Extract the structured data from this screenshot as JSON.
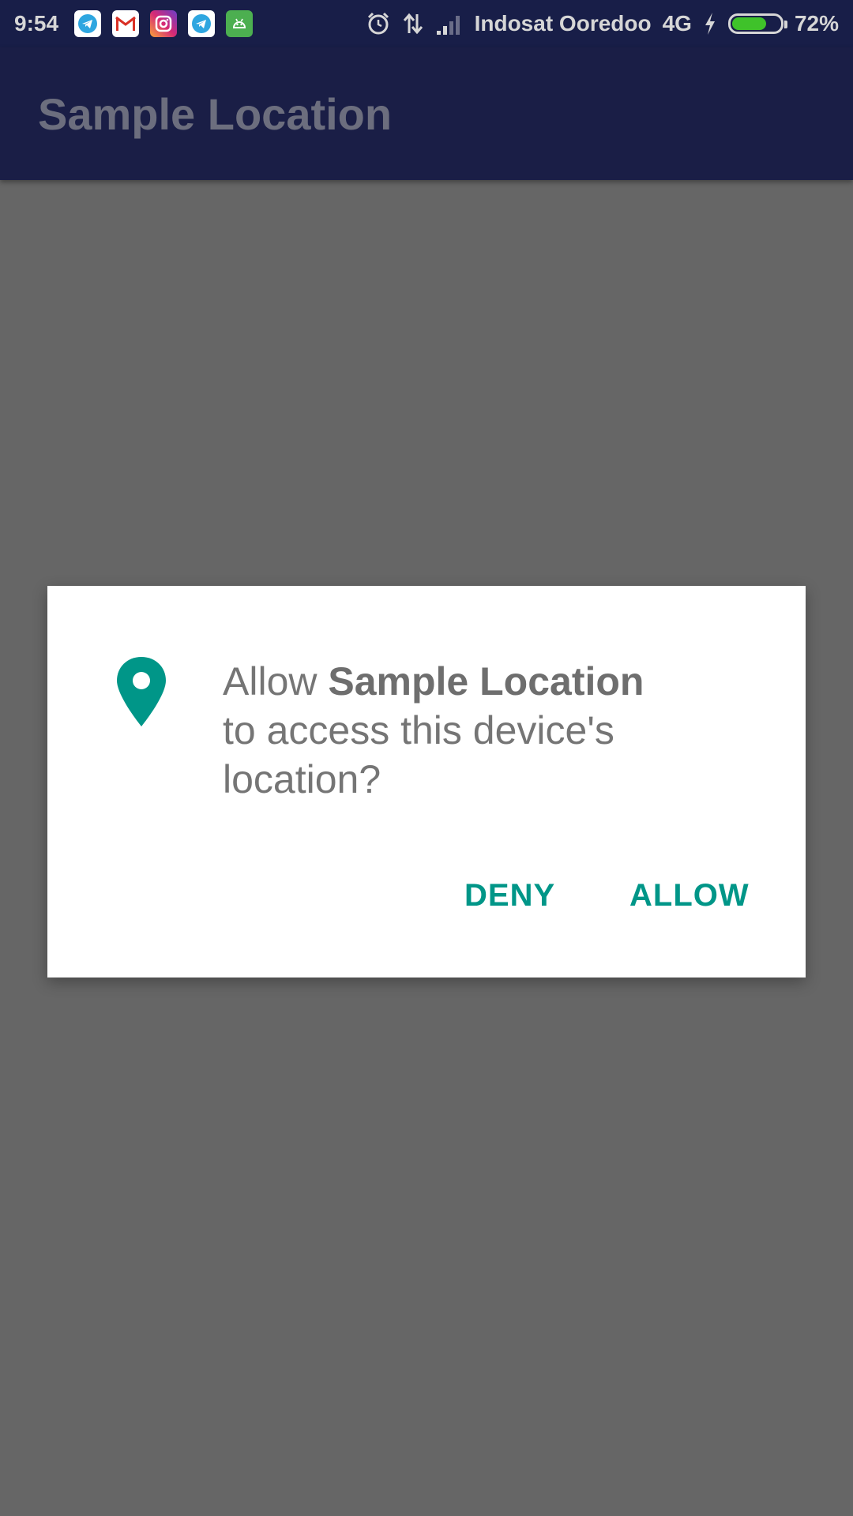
{
  "status_bar": {
    "time": "9:54",
    "notification_icons": [
      "telegram-icon",
      "gmail-icon",
      "instagram-icon",
      "telegram-icon",
      "android-robot-icon"
    ],
    "carrier": "Indosat Ooredoo",
    "network": "4G",
    "battery_percent": "72%",
    "battery_level": 0.72
  },
  "app_bar": {
    "title": "Sample Location"
  },
  "dialog": {
    "message_prefix": "Allow ",
    "app_name": "Sample Location",
    "message_suffix": "to access this device's location?",
    "deny_label": "DENY",
    "allow_label": "ALLOW"
  },
  "colors": {
    "status_bar": "#181e48",
    "app_bar": "#1a1e46",
    "scrim": "#666666",
    "accent": "#009688",
    "battery": "#3fc22a"
  }
}
